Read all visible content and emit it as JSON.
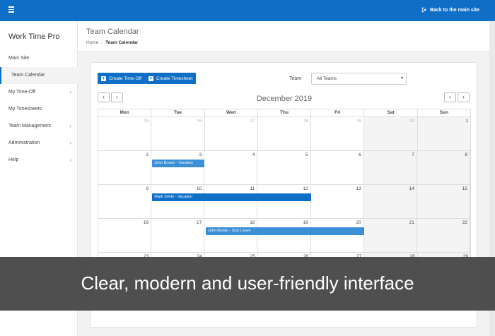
{
  "topbar": {
    "back_link": "Back to the main site",
    "color": "#0f6fc6"
  },
  "sidebar": {
    "brand": "Work Time Pro",
    "items": [
      {
        "label": "Main Site",
        "has_chevron": false
      },
      {
        "label": "Team Calendar",
        "has_chevron": false,
        "active": true
      },
      {
        "label": "My Time-Off",
        "has_chevron": true
      },
      {
        "label": "My Timesheets",
        "has_chevron": false
      },
      {
        "label": "Team Management",
        "has_chevron": true
      },
      {
        "label": "Administration",
        "has_chevron": true
      },
      {
        "label": "Help",
        "has_chevron": true
      }
    ]
  },
  "header": {
    "title": "Team Calendar",
    "breadcrumb": [
      "Home",
      "Team Calendar"
    ]
  },
  "toolbar": {
    "create_timeoff": "Create Time-Off",
    "create_timesheet": "Create Timesheet",
    "team_label": "Team",
    "team_value": "All Teams"
  },
  "calendar": {
    "month": "December 2019",
    "prev": "‹",
    "next": "›",
    "days_of_week": [
      "Mon",
      "Tue",
      "Wed",
      "Thu",
      "Fri",
      "Sat",
      "Sun"
    ],
    "weeks": [
      [
        {
          "n": "25",
          "other": true
        },
        {
          "n": "26",
          "other": true
        },
        {
          "n": "27",
          "other": true
        },
        {
          "n": "28",
          "other": true
        },
        {
          "n": "29",
          "other": true
        },
        {
          "n": "30",
          "other": true
        },
        {
          "n": "1"
        }
      ],
      [
        {
          "n": "2"
        },
        {
          "n": "3"
        },
        {
          "n": "4"
        },
        {
          "n": "5"
        },
        {
          "n": "6"
        },
        {
          "n": "7"
        },
        {
          "n": "8"
        }
      ],
      [
        {
          "n": "9"
        },
        {
          "n": "10"
        },
        {
          "n": "11"
        },
        {
          "n": "12"
        },
        {
          "n": "13"
        },
        {
          "n": "14"
        },
        {
          "n": "15"
        }
      ],
      [
        {
          "n": "16"
        },
        {
          "n": "17"
        },
        {
          "n": "18"
        },
        {
          "n": "19"
        },
        {
          "n": "20"
        },
        {
          "n": "21"
        },
        {
          "n": "22"
        }
      ],
      [
        {
          "n": "23"
        },
        {
          "n": "24"
        },
        {
          "n": "25"
        },
        {
          "n": "26"
        },
        {
          "n": "27"
        },
        {
          "n": "28"
        },
        {
          "n": "29"
        }
      ]
    ],
    "events": [
      {
        "week": 1,
        "start": 1,
        "span": 1,
        "label": "John Brown - Vacation",
        "color": "#3a8fd6"
      },
      {
        "week": 2,
        "start": 1,
        "span": 3,
        "label": "Mark Smith - Vacation",
        "color": "#0f6fc6"
      },
      {
        "week": 3,
        "start": 2,
        "span": 3,
        "label": "John Brown - Sick Leave",
        "color": "#3a8fd6"
      }
    ]
  },
  "banner": {
    "text": "Clear, modern and user-friendly interface"
  }
}
